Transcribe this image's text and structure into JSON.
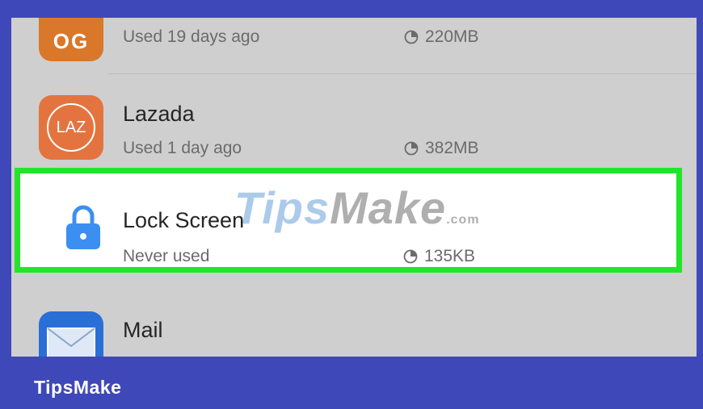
{
  "apps": [
    {
      "id": "oog",
      "name": "",
      "usage": "Used 19 days ago",
      "size": "220MB",
      "icon": "oog-app-icon",
      "icon_text": "OG",
      "icon_color": "#d9782a"
    },
    {
      "id": "lazada",
      "name": "Lazada",
      "usage": "Used 1 day ago",
      "size": "382MB",
      "icon": "lazada-app-icon",
      "icon_text": "LAZ",
      "icon_color": "#e4743f"
    },
    {
      "id": "lockscreen",
      "name": "Lock Screen",
      "usage": "Never used",
      "size": "135KB",
      "icon": "lock-icon",
      "icon_color": "#3b8ff0"
    },
    {
      "id": "mail",
      "name": "Mail",
      "usage": "",
      "size": "",
      "icon": "mail-app-icon",
      "icon_color": "#2a6fd8"
    }
  ],
  "watermark": {
    "tips": "Tips",
    "make": "Make",
    "com": ".com"
  },
  "brand": "TipsMake",
  "colors": {
    "frame": "#3f48b8",
    "highlight": "#22e52a",
    "list_bg": "#cfcfcf"
  }
}
